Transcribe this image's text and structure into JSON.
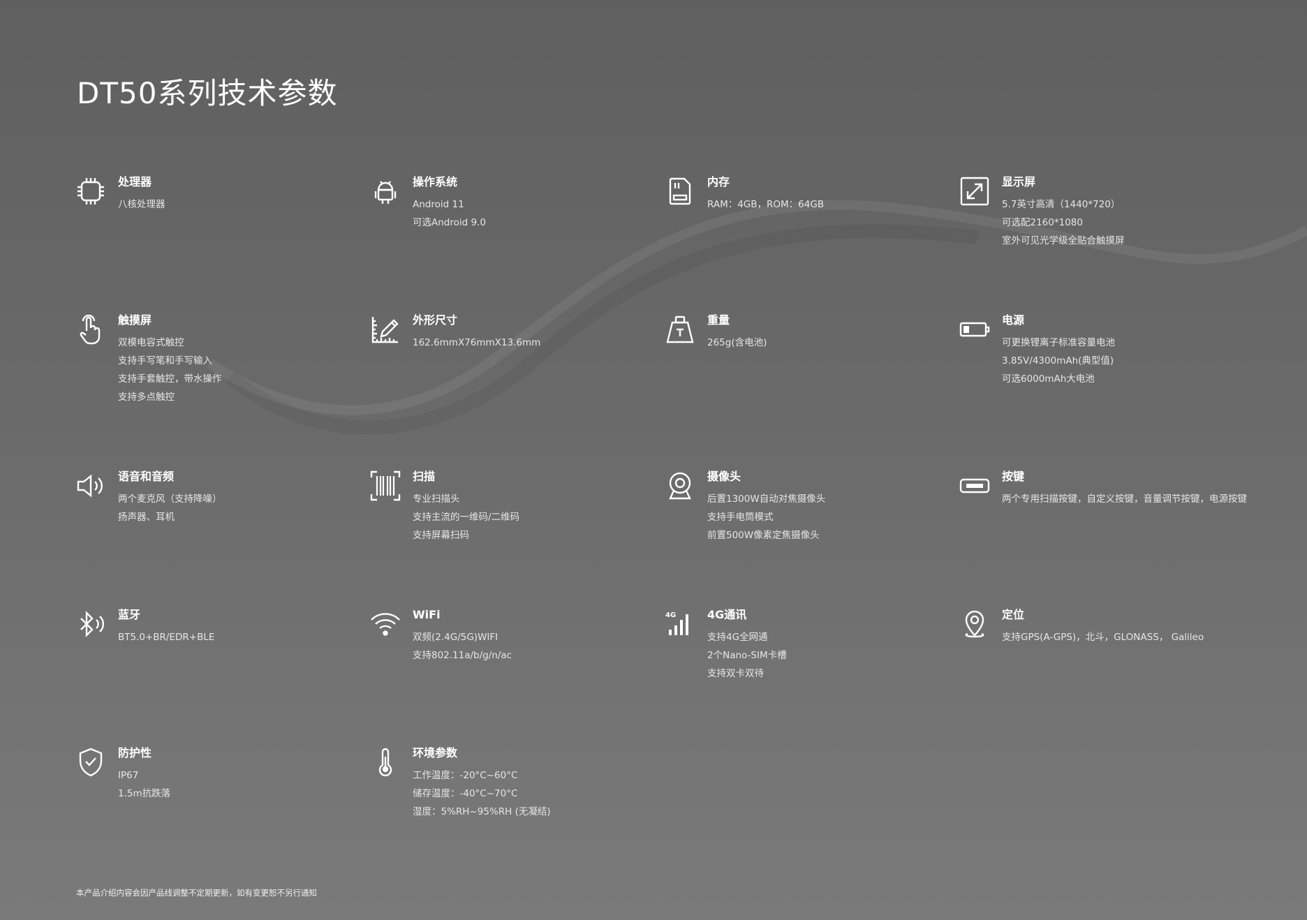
{
  "page": {
    "title": "DT50系列技术参数",
    "footer": "本产品介绍内容会因产品线调整不定期更新，如有变更恕不另行通知"
  },
  "specs": [
    {
      "icon": "cpu-icon",
      "label": "处理器",
      "lines": [
        "八核处理器"
      ]
    },
    {
      "icon": "android-icon",
      "label": "操作系统",
      "lines": [
        "Android 11",
        "可选Android 9.0"
      ]
    },
    {
      "icon": "sd-card-icon",
      "label": "内存",
      "lines": [
        "RAM：4GB，ROM：64GB"
      ]
    },
    {
      "icon": "expand-screen-icon",
      "label": "显示屏",
      "lines": [
        "5.7英寸高清（1440*720）",
        "可选配2160*1080",
        "室外可见光学级全贴合触摸屏"
      ]
    },
    {
      "icon": "touch-hand-icon",
      "label": "触摸屏",
      "lines": [
        "双模电容式触控",
        "支持手写笔和手写输入",
        "支持手套触控，带水操作",
        "支持多点触控"
      ]
    },
    {
      "icon": "ruler-pencil-icon",
      "label": "外形尺寸",
      "lines": [
        "162.6mmX76mmX13.6mm"
      ]
    },
    {
      "icon": "weight-icon",
      "label": "重量",
      "lines": [
        "265g(含电池)"
      ]
    },
    {
      "icon": "battery-icon",
      "label": "电源",
      "lines": [
        "可更换锂离子标准容量电池",
        "3.85V/4300mAh(典型值)",
        "可选6000mAh大电池"
      ]
    },
    {
      "icon": "speaker-icon",
      "label": "语音和音频",
      "lines": [
        "两个麦克风（支持降噪）",
        "扬声器、耳机"
      ]
    },
    {
      "icon": "barcode-scan-icon",
      "label": "扫描",
      "lines": [
        "专业扫描头",
        "支持主流的一维码/二维码",
        "支持屏幕扫码"
      ]
    },
    {
      "icon": "camera-icon",
      "label": "摄像头",
      "lines": [
        "后置1300W自动对焦摄像头",
        "支持手电筒模式",
        "前置500W像素定焦摄像头"
      ]
    },
    {
      "icon": "key-button-icon",
      "label": "按键",
      "lines": [
        "两个专用扫描按键，自定义按键，音量调节按键，电源按键"
      ]
    },
    {
      "icon": "bluetooth-icon",
      "label": "蓝牙",
      "lines": [
        "BT5.0+BR/EDR+BLE"
      ]
    },
    {
      "icon": "wifi-icon",
      "label": "WiFi",
      "lines": [
        "双频(2.4G/5G)WIFI",
        "支持802.11a/b/g/n/ac"
      ]
    },
    {
      "icon": "signal-4g-icon",
      "label": "4G通讯",
      "lines": [
        "支持4G全网通",
        "2个Nano-SIM卡槽",
        "支持双卡双待"
      ]
    },
    {
      "icon": "location-pin-icon",
      "label": "定位",
      "lines": [
        "支持GPS(A-GPS)，北斗，GLONASS， Galileo"
      ]
    },
    {
      "icon": "shield-check-icon",
      "label": "防护性",
      "lines": [
        "IP67",
        "1.5m抗跌落"
      ]
    },
    {
      "icon": "thermometer-icon",
      "label": "环境参数",
      "lines": [
        "工作温度：-20°C~60°C",
        "储存温度：-40°C~70°C",
        "湿度：5%RH~95%RH (无凝结)"
      ]
    }
  ],
  "icon_color": "#ffffff",
  "text_color": "#e6e6e6"
}
